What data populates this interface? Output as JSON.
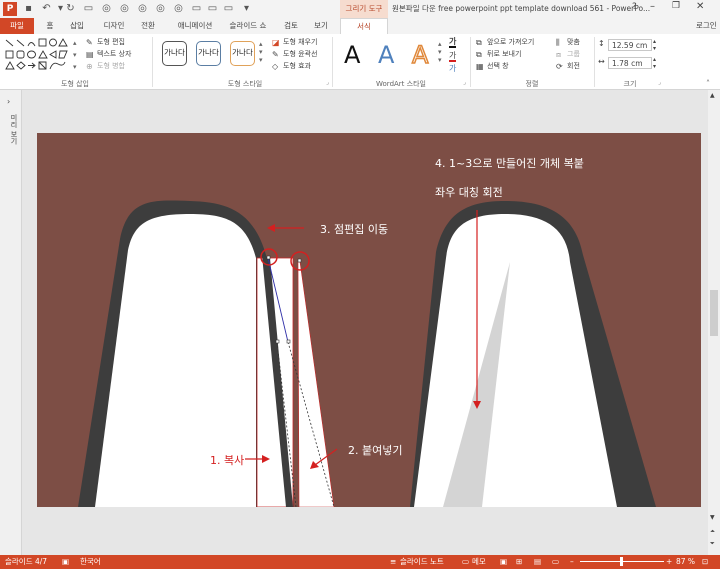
{
  "quick_access": {
    "logo": "P"
  },
  "title": {
    "context_tab": "그리기 도구",
    "document": "원본파일 다운 free powerpoint ppt template download 561 - PowerPo..."
  },
  "tabs": [
    "파일",
    "홈",
    "삽입",
    "디자인",
    "전환",
    "애니메이션",
    "슬라이드 쇼",
    "검토",
    "보기",
    "서식"
  ],
  "signin": "로그인",
  "ribbon": {
    "insert_shapes": {
      "label": "도형 삽입",
      "edit_shape": "도형 편집",
      "text_box": "텍스트 상자",
      "merge_shapes": "도형 병합"
    },
    "shape_styles": {
      "label": "도형 스타일",
      "samples": [
        "가나다",
        "가나다",
        "가나다"
      ],
      "fill": "도형 채우기",
      "outline": "도형 윤곽선",
      "effects": "도형 효과"
    },
    "wordart": {
      "label": "WordArt 스타일",
      "letters": [
        "A",
        "A",
        "A"
      ]
    },
    "arrange": {
      "label": "정렬",
      "bring_forward": "앞으로 가져오기",
      "send_backward": "뒤로 보내기",
      "selection_pane": "선택 창",
      "align": "맞춤",
      "group": "그룹",
      "rotate": "회전"
    },
    "size": {
      "label": "크기",
      "height": "12.59 cm",
      "width": "1.78 cm"
    }
  },
  "left_pane_label": "미리 보기",
  "slide": {
    "annotations": {
      "step4_line1": "4. 1~3으로 만들어진 개체 복붙",
      "step4_line2": "좌우 대칭 회전",
      "step3": "3. 점편집 이동",
      "step1": "1. 복사",
      "step2": "2. 붙여넣기"
    },
    "colors": {
      "background": "#7d4e45",
      "arch_dark": "#3d3d3d",
      "arch_white": "#ffffff",
      "annotation_red": "#d42020",
      "grey_triangle": "#d4d4d4"
    }
  },
  "status": {
    "slide_counter": "슬라이드 4/7",
    "language": "한국어",
    "notes": "슬라이드 노트",
    "comments": "메모",
    "zoom": "87 %"
  }
}
